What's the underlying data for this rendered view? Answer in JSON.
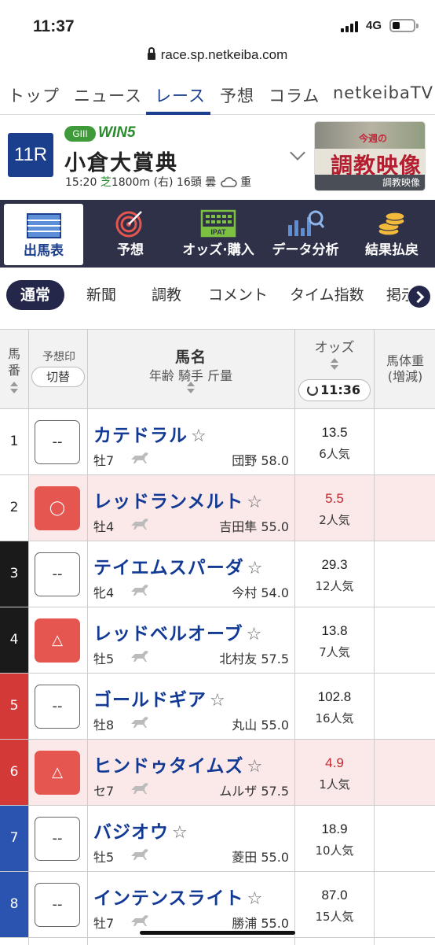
{
  "status": {
    "time": "11:37",
    "network": "4G"
  },
  "url": "race.sp.netkeiba.com",
  "nav": {
    "tabs": [
      "トップ",
      "ニュース",
      "レース",
      "予想",
      "コラム",
      "netkeibaTV"
    ],
    "active": 2
  },
  "race": {
    "number": "11R",
    "grade": "GIII",
    "win5": "WIN5",
    "name": "小倉大賞典",
    "time": "15:20",
    "surface": "芝",
    "distance": "1800m (右)",
    "runners": "16頭",
    "weather": "曇",
    "condition": "重",
    "banner": {
      "top": "今週の",
      "title": "調教映像",
      "caption": "調教映像"
    }
  },
  "categories": [
    {
      "label": "出馬表",
      "icon": "race-card-icon"
    },
    {
      "label": "予想",
      "icon": "target-icon"
    },
    {
      "label": "オッズ·購入",
      "icon": "ipat-icon"
    },
    {
      "label": "データ分析",
      "icon": "chart-magnifier-icon"
    },
    {
      "label": "結果払戻",
      "icon": "coins-icon"
    }
  ],
  "subtabs": [
    "通常",
    "新聞",
    "調教",
    "コメント",
    "タイム指数",
    "掲示"
  ],
  "table": {
    "col_umaban": "馬番",
    "col_mark": "予想印",
    "switch_label": "切替",
    "col_name": "馬名",
    "col_name_sub": "年齢 騎手 斤量",
    "col_odds": "オッズ",
    "odds_time": "11:36",
    "col_weight": "馬体重",
    "col_weight_sub": "(増減)"
  },
  "horses": [
    {
      "num": "1",
      "mark": "--",
      "name": "カテドラル",
      "sex_age": "牡7",
      "jockey": "団野 58.0",
      "odds": "13.5",
      "pop": "6人気",
      "hot": false
    },
    {
      "num": "2",
      "mark": "◯",
      "name": "レッドランメルト",
      "sex_age": "牡4",
      "jockey": "吉田隼 55.0",
      "odds": "5.5",
      "pop": "2人気",
      "hot": true
    },
    {
      "num": "3",
      "mark": "--",
      "name": "テイエムスパーダ",
      "sex_age": "牝4",
      "jockey": "今村 54.0",
      "odds": "29.3",
      "pop": "12人気",
      "hot": false
    },
    {
      "num": "4",
      "mark": "△",
      "name": "レッドベルオーブ",
      "sex_age": "牡5",
      "jockey": "北村友 57.5",
      "odds": "13.8",
      "pop": "7人気",
      "hot": false
    },
    {
      "num": "5",
      "mark": "--",
      "name": "ゴールドギア",
      "sex_age": "牡8",
      "jockey": "丸山 55.0",
      "odds": "102.8",
      "pop": "16人気",
      "hot": false
    },
    {
      "num": "6",
      "mark": "△",
      "name": "ヒンドゥタイムズ",
      "sex_age": "セ7",
      "jockey": "ムルザ 57.5",
      "odds": "4.9",
      "pop": "1人気",
      "hot": true
    },
    {
      "num": "7",
      "mark": "--",
      "name": "バジオウ",
      "sex_age": "牡5",
      "jockey": "菱田 55.0",
      "odds": "18.9",
      "pop": "10人気",
      "hot": false
    },
    {
      "num": "8",
      "mark": "--",
      "name": "インテンスライト",
      "sex_age": "牡7",
      "jockey": "勝浦 55.0",
      "odds": "87.0",
      "pop": "15人気",
      "hot": false
    }
  ],
  "colors": {
    "accent": "#1b3f8c",
    "category_bar": "#2e3148",
    "mark_red": "#e4564f",
    "gate": [
      "#ffffff",
      "#ffffff",
      "#1a1a1a",
      "#1a1a1a",
      "#d33a37",
      "#d33a37",
      "#2b54b0",
      "#2b54b0"
    ],
    "gate_text": [
      "#222222",
      "#222222",
      "#ffffff",
      "#ffffff",
      "#ffffff",
      "#ffffff",
      "#ffffff",
      "#ffffff"
    ]
  }
}
